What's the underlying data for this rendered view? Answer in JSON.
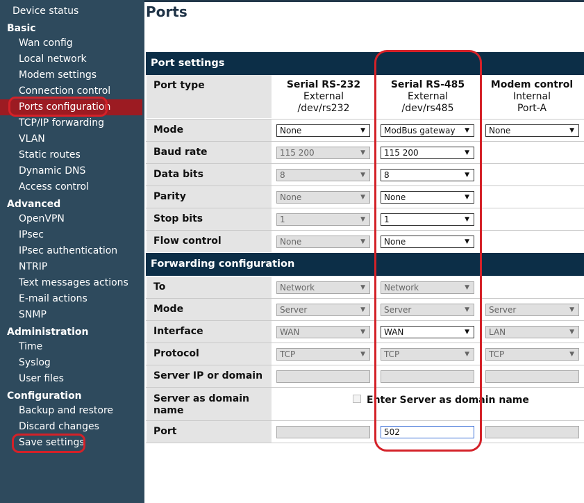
{
  "sidebar": {
    "top_item": "Device status",
    "sections": [
      {
        "title": "Basic",
        "items": [
          "Wan config",
          "Local network",
          "Modem settings",
          "Connection control",
          "Ports configuration",
          "TCP/IP forwarding",
          "VLAN",
          "Static routes",
          "Dynamic DNS",
          "Access control"
        ]
      },
      {
        "title": "Advanced",
        "items": [
          "OpenVPN",
          "IPsec",
          "IPsec authentication",
          "NTRIP",
          "Text messages actions",
          "E-mail actions",
          "SNMP"
        ]
      },
      {
        "title": "Administration",
        "items": [
          "Time",
          "Syslog",
          "User files"
        ]
      },
      {
        "title": "Configuration",
        "items": [
          "Backup and restore",
          "Discard changes",
          "Save settings"
        ]
      }
    ],
    "active_item": "Ports configuration"
  },
  "page": {
    "title": "Ports"
  },
  "table": {
    "port_settings_header": "Port settings",
    "forwarding_header": "Forwarding configuration",
    "port_type_label": "Port type",
    "columns": [
      {
        "title": "Serial RS-232",
        "location": "External",
        "device": "/dev/rs232"
      },
      {
        "title": "Serial RS-485",
        "location": "External",
        "device": "/dev/rs485"
      },
      {
        "title": "Modem control",
        "location": "Internal",
        "device": "Port-A"
      }
    ],
    "labels": {
      "mode": "Mode",
      "baud_rate": "Baud rate",
      "data_bits": "Data bits",
      "parity": "Parity",
      "stop_bits": "Stop bits",
      "flow_control": "Flow control",
      "to": "To",
      "fwd_mode": "Mode",
      "interface": "Interface",
      "protocol": "Protocol",
      "server_ip": "Server IP or domain",
      "server_as_domain": "Server as domain name",
      "port": "Port"
    },
    "values": {
      "rs232": {
        "mode": "None",
        "baud_rate": "115 200",
        "data_bits": "8",
        "parity": "None",
        "stop_bits": "1",
        "flow_control": "None",
        "to": "Network",
        "fwd_mode": "Server",
        "interface": "WAN",
        "protocol": "TCP",
        "server_ip": "",
        "port": ""
      },
      "rs485": {
        "mode": "ModBus gateway",
        "baud_rate": "115 200",
        "data_bits": "8",
        "parity": "None",
        "stop_bits": "1",
        "flow_control": "None",
        "to": "Network",
        "fwd_mode": "Server",
        "interface": "WAN",
        "protocol": "TCP",
        "server_ip": "",
        "port": "502"
      },
      "modem": {
        "mode": "None",
        "fwd_mode": "Server",
        "interface": "LAN",
        "protocol": "TCP",
        "server_ip": "",
        "port": ""
      }
    },
    "checkbox_label": "Enter Server as domain name",
    "checkbox_checked": false
  },
  "icons": {
    "dropdown": "triangle-down-icon"
  },
  "colors": {
    "sidebar_bg": "#2e4a5d",
    "active_item_bg": "#9c1b22",
    "section_header_bg": "#0c2e47",
    "highlight_red": "#d42128"
  }
}
